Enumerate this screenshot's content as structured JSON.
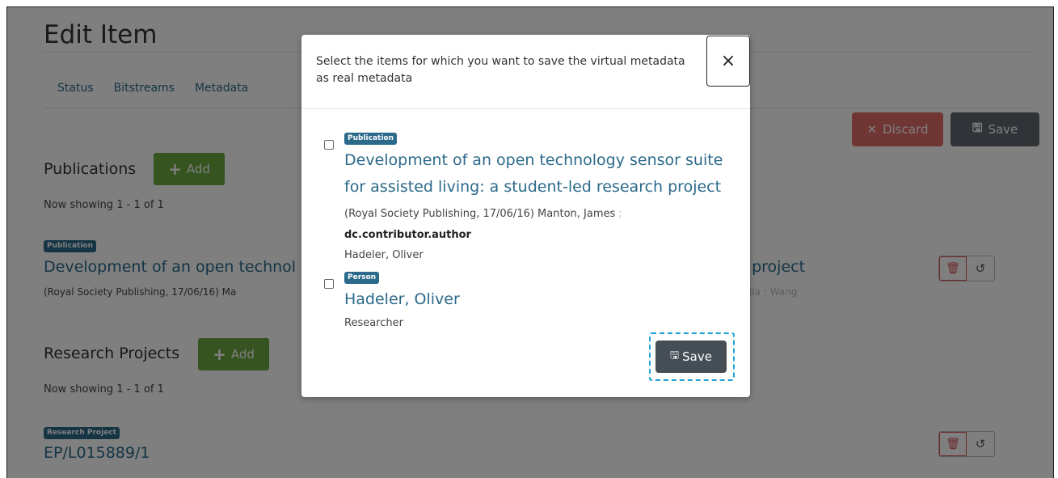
{
  "page": {
    "title": "Edit Item",
    "tabs": [
      "Status",
      "Bitstreams",
      "Metadata"
    ],
    "discard_label": "Discard",
    "save_label": "Save"
  },
  "publications": {
    "heading": "Publications",
    "add_label": "Add",
    "showing": "Now showing 1 - 1 of 1",
    "item": {
      "type": "Publication",
      "title_left": "Development of an open technol",
      "title_right": "h project",
      "meta_left": "(Royal Society Publishing, 17/06/16) Ma",
      "meta_right": "bella ; Wang"
    }
  },
  "research_projects": {
    "heading": "Research Projects",
    "add_label": "Add",
    "showing": "Now showing 1 - 1 of 1",
    "item": {
      "type": "Research Project",
      "title": "EP/L015889/1"
    }
  },
  "modal": {
    "title": "Select the items for which you want to save the virtual metadata as real metadata",
    "close_symbol": "×",
    "items": [
      {
        "type": "Publication",
        "title_line1": "Development of an open technology sensor suite",
        "title_line2": "for assisted living: a student-led research project",
        "meta": "(Royal Society Publishing, 17/06/16) Manton, James",
        "meta_faded": " ;",
        "field": "dc.contributor.author",
        "value": "Hadeler, Oliver"
      },
      {
        "type": "Person",
        "title": "Hadeler, Oliver",
        "role": "Researcher"
      }
    ],
    "save_label": "Save"
  },
  "colors": {
    "brand_link": "#2b6a8a",
    "add_green": "#6ba840",
    "danger": "#d9534f",
    "dark": "#454d55",
    "focus": "#1da1d8"
  }
}
